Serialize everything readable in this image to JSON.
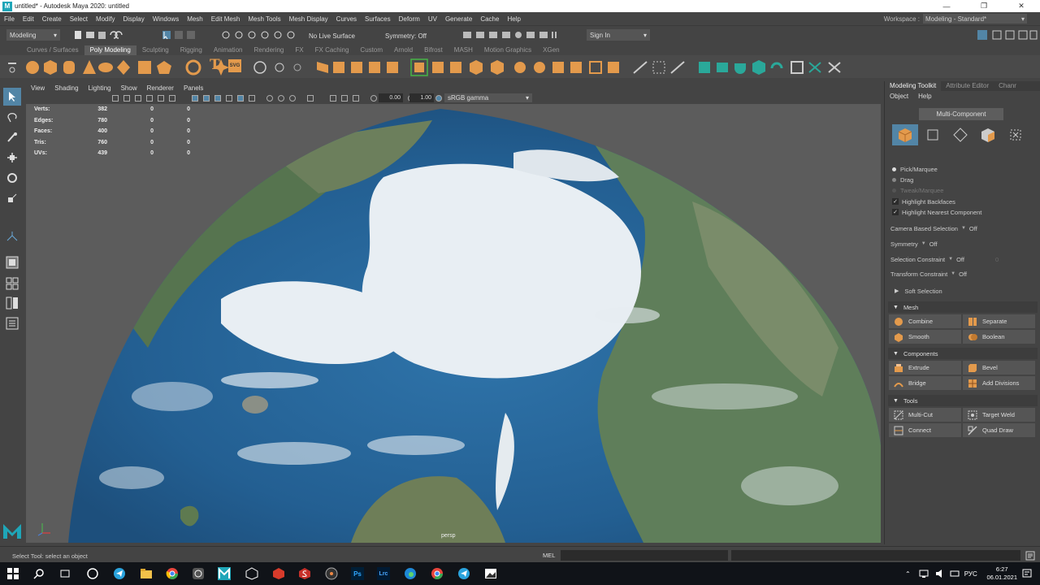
{
  "window": {
    "title": "untitled* - Autodesk Maya 2020: untitled",
    "logo_letter": "M",
    "controls": [
      "—",
      "❐",
      "✕"
    ]
  },
  "menubar": {
    "items": [
      "File",
      "Edit",
      "Create",
      "Select",
      "Modify",
      "Display",
      "Windows",
      "Mesh",
      "Edit Mesh",
      "Mesh Tools",
      "Mesh Display",
      "Curves",
      "Surfaces",
      "Deform",
      "UV",
      "Generate",
      "Cache",
      "Help"
    ],
    "workspace_label": "Workspace :",
    "workspace_value": "Modeling - Standard*"
  },
  "statusline": {
    "menuset": "Modeling",
    "live_surface": "No Live Surface",
    "symmetry": "Symmetry: Off",
    "sign_in": "Sign In"
  },
  "shelf": {
    "tabs": [
      "Curves / Surfaces",
      "Poly Modeling",
      "Sculpting",
      "Rigging",
      "Animation",
      "Rendering",
      "FX",
      "FX Caching",
      "Custom",
      "Arnold",
      "Bifrost",
      "MASH",
      "Motion Graphics",
      "XGen"
    ],
    "active_tab": "Poly Modeling",
    "text_icon": "T",
    "svg_icon": "SVG"
  },
  "viewport": {
    "menu": [
      "View",
      "Shading",
      "Lighting",
      "Show",
      "Renderer",
      "Panels"
    ],
    "gamma_value_1": "0.00",
    "gamma_value_2": "1.00",
    "color_space": "sRGB gamma",
    "camera": "persp",
    "hud": [
      {
        "label": "Verts:",
        "v1": "382",
        "v2": "0",
        "v3": "0"
      },
      {
        "label": "Edges:",
        "v1": "780",
        "v2": "0",
        "v3": "0"
      },
      {
        "label": "Faces:",
        "v1": "400",
        "v2": "0",
        "v3": "0"
      },
      {
        "label": "Tris:",
        "v1": "760",
        "v2": "0",
        "v3": "0"
      },
      {
        "label": "UVs:",
        "v1": "439",
        "v2": "0",
        "v3": "0"
      }
    ]
  },
  "right_panel": {
    "tabs": [
      "Modeling Toolkit",
      "Attribute Editor",
      "Chanr"
    ],
    "submenu": [
      "Object",
      "Help"
    ],
    "multi_component": "Multi-Component",
    "pick_options": [
      "Pick/Marquee",
      "Drag",
      "Tweak/Marquee"
    ],
    "checks": [
      "Highlight Backfaces",
      "Highlight Nearest Component"
    ],
    "check_mark": "✓",
    "camera_based_selection": {
      "label": "Camera Based Selection",
      "value": "Off"
    },
    "symmetry": {
      "label": "Symmetry",
      "value": "Off"
    },
    "selection_constraint": {
      "label": "Selection Constraint",
      "value": "Off",
      "extra": "0"
    },
    "transform_constraint": {
      "label": "Transform Constraint",
      "value": "Off"
    },
    "soft_selection": "Soft Selection",
    "sections": {
      "mesh": {
        "title": "Mesh",
        "buttons": [
          "Combine",
          "Separate",
          "Smooth",
          "Boolean"
        ]
      },
      "components": {
        "title": "Components",
        "buttons": [
          "Extrude",
          "Bevel",
          "Bridge",
          "Add Divisions"
        ]
      },
      "tools": {
        "title": "Tools",
        "buttons": [
          "Multi-Cut",
          "Target Weld",
          "Connect",
          "Quad Draw"
        ]
      }
    }
  },
  "helpline": {
    "text": "Select Tool: select an object",
    "mel": "MEL"
  },
  "taskbar": {
    "lang": "РУС",
    "time": "6:27",
    "date": "06.01.2021",
    "ps": "Ps",
    "lrc": "Lrc"
  },
  "colors": {
    "accent_blue": "#5285a6",
    "icon_orange": "#e39a4c",
    "icon_teal": "#2aa89a",
    "ocean": "#2a6a9e",
    "ice": "#e8eef3"
  }
}
